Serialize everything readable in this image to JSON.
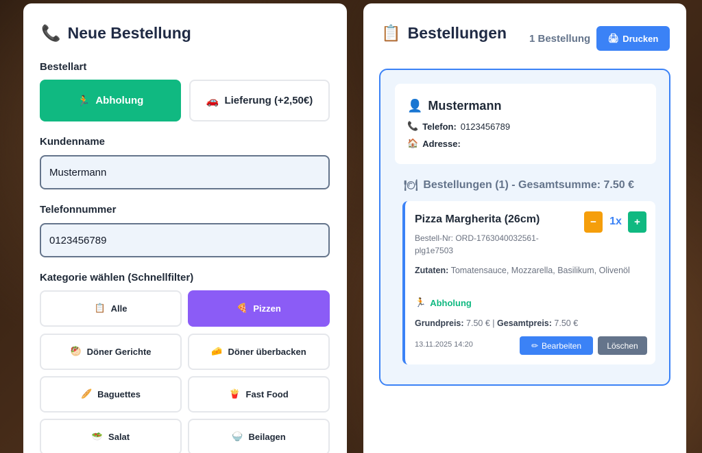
{
  "left": {
    "title": "Neue Bestellung",
    "title_icon": "telephone-receiver-icon",
    "order_type_label": "Bestellart",
    "order_types": [
      {
        "label": "Abholung",
        "icon": "runner-icon",
        "active": true
      },
      {
        "label": "Lieferung (+2,50€)",
        "icon": "car-icon",
        "active": false
      }
    ],
    "customer_label": "Kundenname",
    "customer_value": "Mustermann",
    "phone_label": "Telefonnummer",
    "phone_value": "0123456789",
    "category_label": "Kategorie wählen (Schnellfilter)",
    "categories": [
      {
        "label": "Alle",
        "icon": "clipboard-icon",
        "active": false
      },
      {
        "label": "Pizzen",
        "icon": "pizza-icon",
        "active": true
      },
      {
        "label": "Döner Gerichte",
        "icon": "stuffed-flatbread-icon",
        "active": false
      },
      {
        "label": "Döner überbacken",
        "icon": "cheese-icon",
        "active": false
      },
      {
        "label": "Baguettes",
        "icon": "baguette-icon",
        "active": false
      },
      {
        "label": "Fast Food",
        "icon": "fries-icon",
        "active": false
      },
      {
        "label": "Salat",
        "icon": "salad-icon",
        "active": false
      },
      {
        "label": "Beilagen",
        "icon": "rice-icon",
        "active": false
      }
    ]
  },
  "right": {
    "title": "Bestellungen",
    "title_icon": "clipboard-icon",
    "count": "1 Bestellung",
    "print_label": "Drucken",
    "customer": {
      "name": "Mustermann",
      "phone_label": "Telefon:",
      "phone": "0123456789",
      "address_label": "Adresse:",
      "address": ""
    },
    "orders_heading": "Bestellungen (1) - Gesamtsumme: 7.50 €",
    "order": {
      "title": "Pizza Margherita (26cm)",
      "order_nr": "Bestell-Nr: ORD-1763040032561-plg1e7503",
      "ingredients_label": "Zutaten:",
      "ingredients": "Tomatensauce, Mozzarella, Basilikum, Olivenöl",
      "type": "Abholung",
      "base_label": "Grundpreis:",
      "base_price": "7.50 €",
      "sep": "|",
      "total_label": "Gesamtpreis:",
      "total_price": "7.50 €",
      "date": "13.11.2025 14:20",
      "qty": "1x",
      "minus": "−",
      "plus": "+",
      "edit_label": "Bearbeiten",
      "delete_label": "Löschen"
    }
  },
  "colors": {
    "green": "#10b981",
    "purple": "#8b5cf6",
    "blue": "#3b82f6",
    "orange": "#f59e0b",
    "slate": "#64748b"
  }
}
